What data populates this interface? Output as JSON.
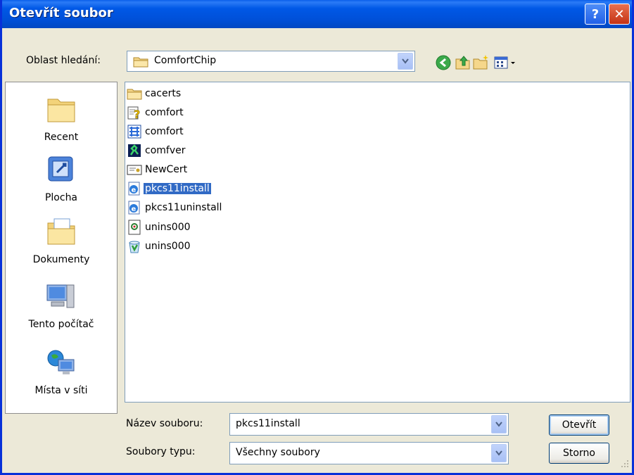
{
  "title": "Otevřít soubor",
  "lookin": {
    "label": "Oblast hledání:",
    "value": "ComfortChip"
  },
  "places": [
    "Recent",
    "Plocha",
    "Dokumenty",
    "Tento počítač",
    "Místa v síti"
  ],
  "files": [
    {
      "name": "cacerts",
      "icon": "folder-icon"
    },
    {
      "name": "comfort",
      "icon": "help-file-icon"
    },
    {
      "name": "comfort",
      "icon": "application-icon"
    },
    {
      "name": "comfver",
      "icon": "executable-icon"
    },
    {
      "name": "NewCert",
      "icon": "certificate-icon"
    },
    {
      "name": "pkcs11install",
      "icon": "html-file-icon",
      "selected": true
    },
    {
      "name": "pkcs11uninstall",
      "icon": "html-file-icon"
    },
    {
      "name": "unins000",
      "icon": "dat-file-icon"
    },
    {
      "name": "unins000",
      "icon": "uninstaller-icon"
    }
  ],
  "filename": {
    "label": "Název souboru:",
    "value": "pkcs11install"
  },
  "filetype": {
    "label": "Soubory typu:",
    "value": "Všechny soubory"
  },
  "buttons": {
    "open": "Otevřít",
    "cancel": "Storno"
  },
  "titlebar": {
    "help": "?",
    "close": "✕"
  }
}
